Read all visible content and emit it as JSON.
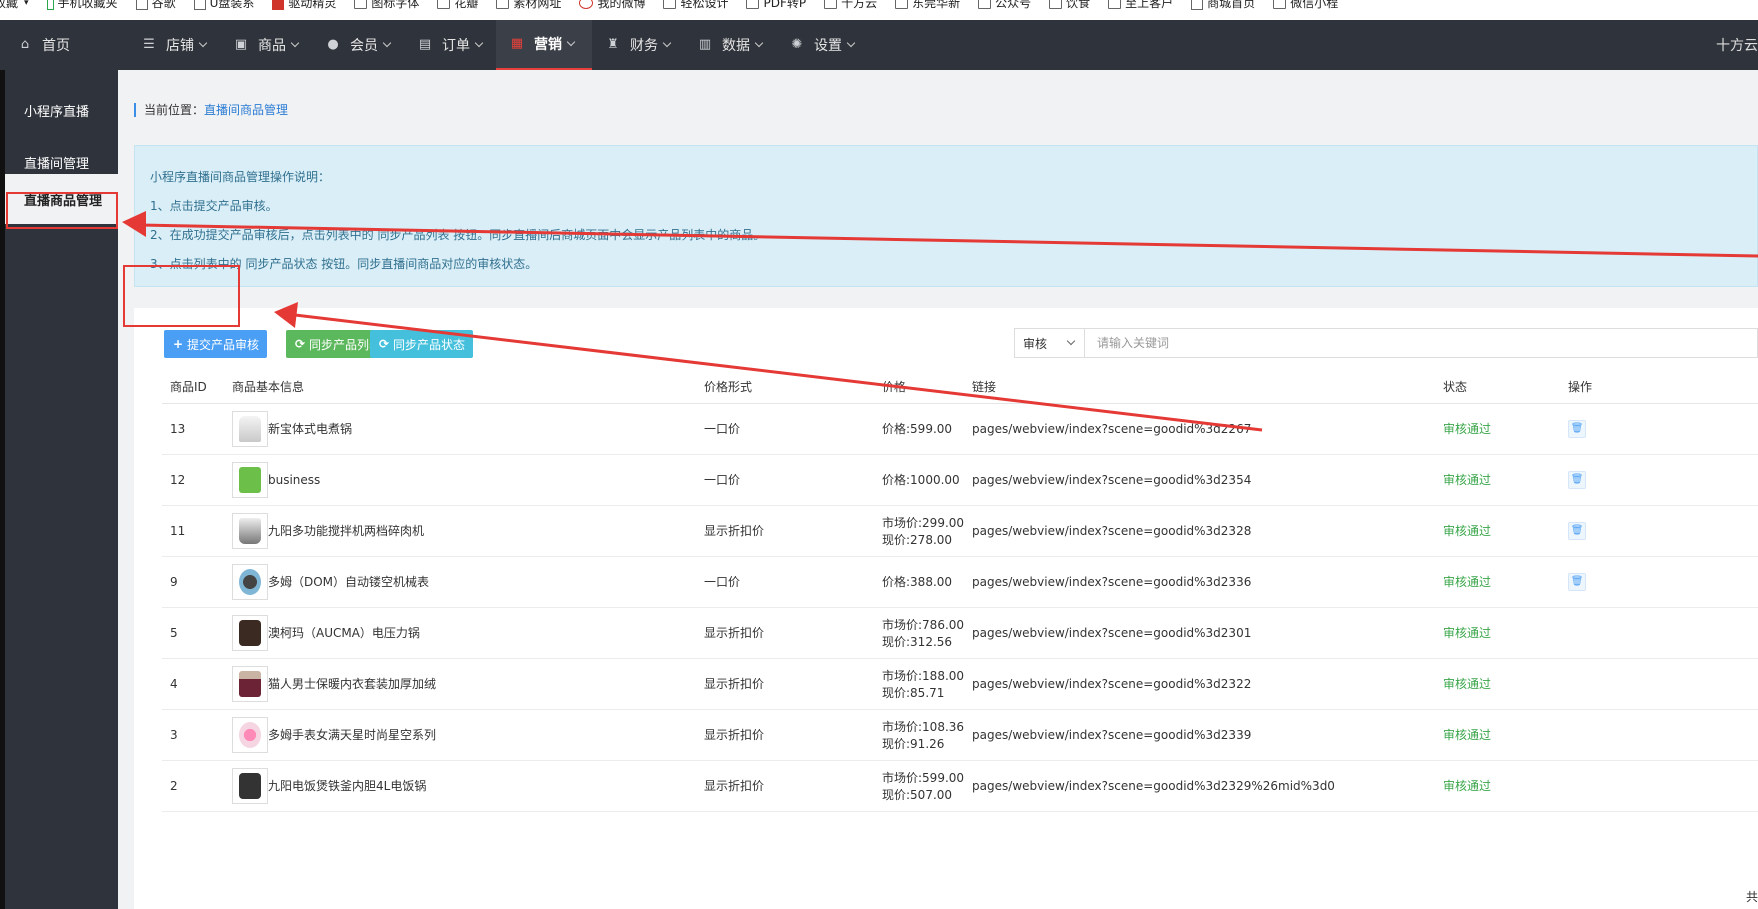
{
  "bookmarks": [
    {
      "label": "收藏",
      "icon": "none"
    },
    {
      "label": "手机收藏夹",
      "icon": "phone-icon"
    },
    {
      "label": "谷歌",
      "icon": "page-icon"
    },
    {
      "label": "U盘装系",
      "icon": "page-icon"
    },
    {
      "label": "驱动精灵",
      "icon": "app-icon"
    },
    {
      "label": "图标字体",
      "icon": "page-icon"
    },
    {
      "label": "花瓣",
      "icon": "page-icon"
    },
    {
      "label": "素材网址",
      "icon": "page-icon"
    },
    {
      "label": "我的微博",
      "icon": "weibo-icon"
    },
    {
      "label": "轻松设计",
      "icon": "page-icon"
    },
    {
      "label": "PDF转P",
      "icon": "page-icon"
    },
    {
      "label": "十方云",
      "icon": "page-icon"
    },
    {
      "label": "东莞华新",
      "icon": "page-icon"
    },
    {
      "label": "公众号",
      "icon": "page-icon"
    },
    {
      "label": "饮食",
      "icon": "page-icon"
    },
    {
      "label": "至上客户",
      "icon": "page-icon"
    },
    {
      "label": "商城首页",
      "icon": "page-icon"
    },
    {
      "label": "微信小程",
      "icon": "page-icon"
    }
  ],
  "topnav": {
    "home": "首页",
    "items": [
      {
        "label": "店铺",
        "icon": "store-icon"
      },
      {
        "label": "商品",
        "icon": "product-icon"
      },
      {
        "label": "会员",
        "icon": "user-icon"
      },
      {
        "label": "订单",
        "icon": "order-icon"
      },
      {
        "label": "营销",
        "icon": "gift-icon",
        "active": true
      },
      {
        "label": "财务",
        "icon": "money-bag-icon"
      },
      {
        "label": "数据",
        "icon": "bar-chart-icon"
      },
      {
        "label": "设置",
        "icon": "gear-icon"
      }
    ],
    "right_text": "十方云"
  },
  "sidebar": {
    "items": [
      {
        "label": "小程序直播"
      },
      {
        "label": "直播间管理"
      },
      {
        "label": "直播商品管理",
        "active": true
      }
    ]
  },
  "breadcrumb": {
    "prefix": "当前位置：",
    "current": "直播间商品管理"
  },
  "notice": {
    "title": "小程序直播间商品管理操作说明：",
    "lines": [
      "1、点击提交产品审核。",
      "2、在成功提交产品审核后，点击列表中的 同步产品列表 按钮。同步直播间后商城页面中会显示产品列表中的商品。",
      "3、点击列表中的 同步产品状态 按钮。同步直播间商品对应的审核状态。"
    ]
  },
  "toolbar": {
    "submit": "提交产品审核",
    "sync_list": "同步产品列表",
    "sync_status": "同步产品状态"
  },
  "filter": {
    "select_value": "审核",
    "placeholder": "请输入关键词"
  },
  "table": {
    "headers": [
      "商品ID",
      "商品基本信息",
      "价格形式",
      "价格",
      "链接",
      "状态",
      "操作"
    ],
    "rows": [
      {
        "id": "13",
        "name": "新宝体式电煮锅",
        "price_type": "一口价",
        "price1": "价格:599.00",
        "price2": "",
        "link": "pages/webview/index?scene=goodid%3d2267",
        "status": "审核通过",
        "thumb": "kettle-icon",
        "deletable": true
      },
      {
        "id": "12",
        "name": "business",
        "price_type": "一口价",
        "price1": "价格:1000.00",
        "price2": "",
        "link": "pages/webview/index?scene=goodid%3d2354",
        "status": "审核通过",
        "thumb": "chat-bubble-icon",
        "deletable": true
      },
      {
        "id": "11",
        "name": "九阳多功能搅拌机两档碎肉机",
        "price_type": "显示折扣价",
        "price1": "市场价:299.00",
        "price2": "现价:278.00",
        "link": "pages/webview/index?scene=goodid%3d2328",
        "status": "审核通过",
        "thumb": "blender-icon",
        "deletable": true
      },
      {
        "id": "9",
        "name": "多姆（DOM）自动镂空机械表",
        "price_type": "一口价",
        "price1": "价格:388.00",
        "price2": "",
        "link": "pages/webview/index?scene=goodid%3d2336",
        "status": "审核通过",
        "thumb": "watch-icon",
        "deletable": true
      },
      {
        "id": "5",
        "name": "澳柯玛（AUCMA）电压力锅",
        "price_type": "显示折扣价",
        "price1": "市场价:786.00",
        "price2": "现价:312.56",
        "link": "pages/webview/index?scene=goodid%3d2301",
        "status": "审核通过",
        "thumb": "pressure-cooker-icon",
        "deletable": false
      },
      {
        "id": "4",
        "name": "猫人男士保暖内衣套装加厚加绒",
        "price_type": "显示折扣价",
        "price1": "市场价:188.00",
        "price2": "现价:85.71",
        "link": "pages/webview/index?scene=goodid%3d2322",
        "status": "审核通过",
        "thumb": "clothing-icon",
        "deletable": false
      },
      {
        "id": "3",
        "name": "多姆手表女满天星时尚星空系列",
        "price_type": "显示折扣价",
        "price1": "市场价:108.36",
        "price2": "现价:91.26",
        "link": "pages/webview/index?scene=goodid%3d2339",
        "status": "审核通过",
        "thumb": "ladies-watch-icon",
        "deletable": false
      },
      {
        "id": "2",
        "name": "九阳电饭煲铁釜内胆4L电饭锅",
        "price_type": "显示折扣价",
        "price1": "市场价:599.00",
        "price2": "现价:507.00",
        "link": "pages/webview/index?scene=goodid%3d2329%26mid%3d0",
        "status": "审核通过",
        "thumb": "rice-cooker-icon",
        "deletable": false
      }
    ]
  },
  "pager_text": "共",
  "colors": {
    "nav_bg": "#2f333b",
    "accent_blue": "#4a9ff5",
    "status_green": "#3aa64a",
    "annotation_red": "#e53935"
  }
}
